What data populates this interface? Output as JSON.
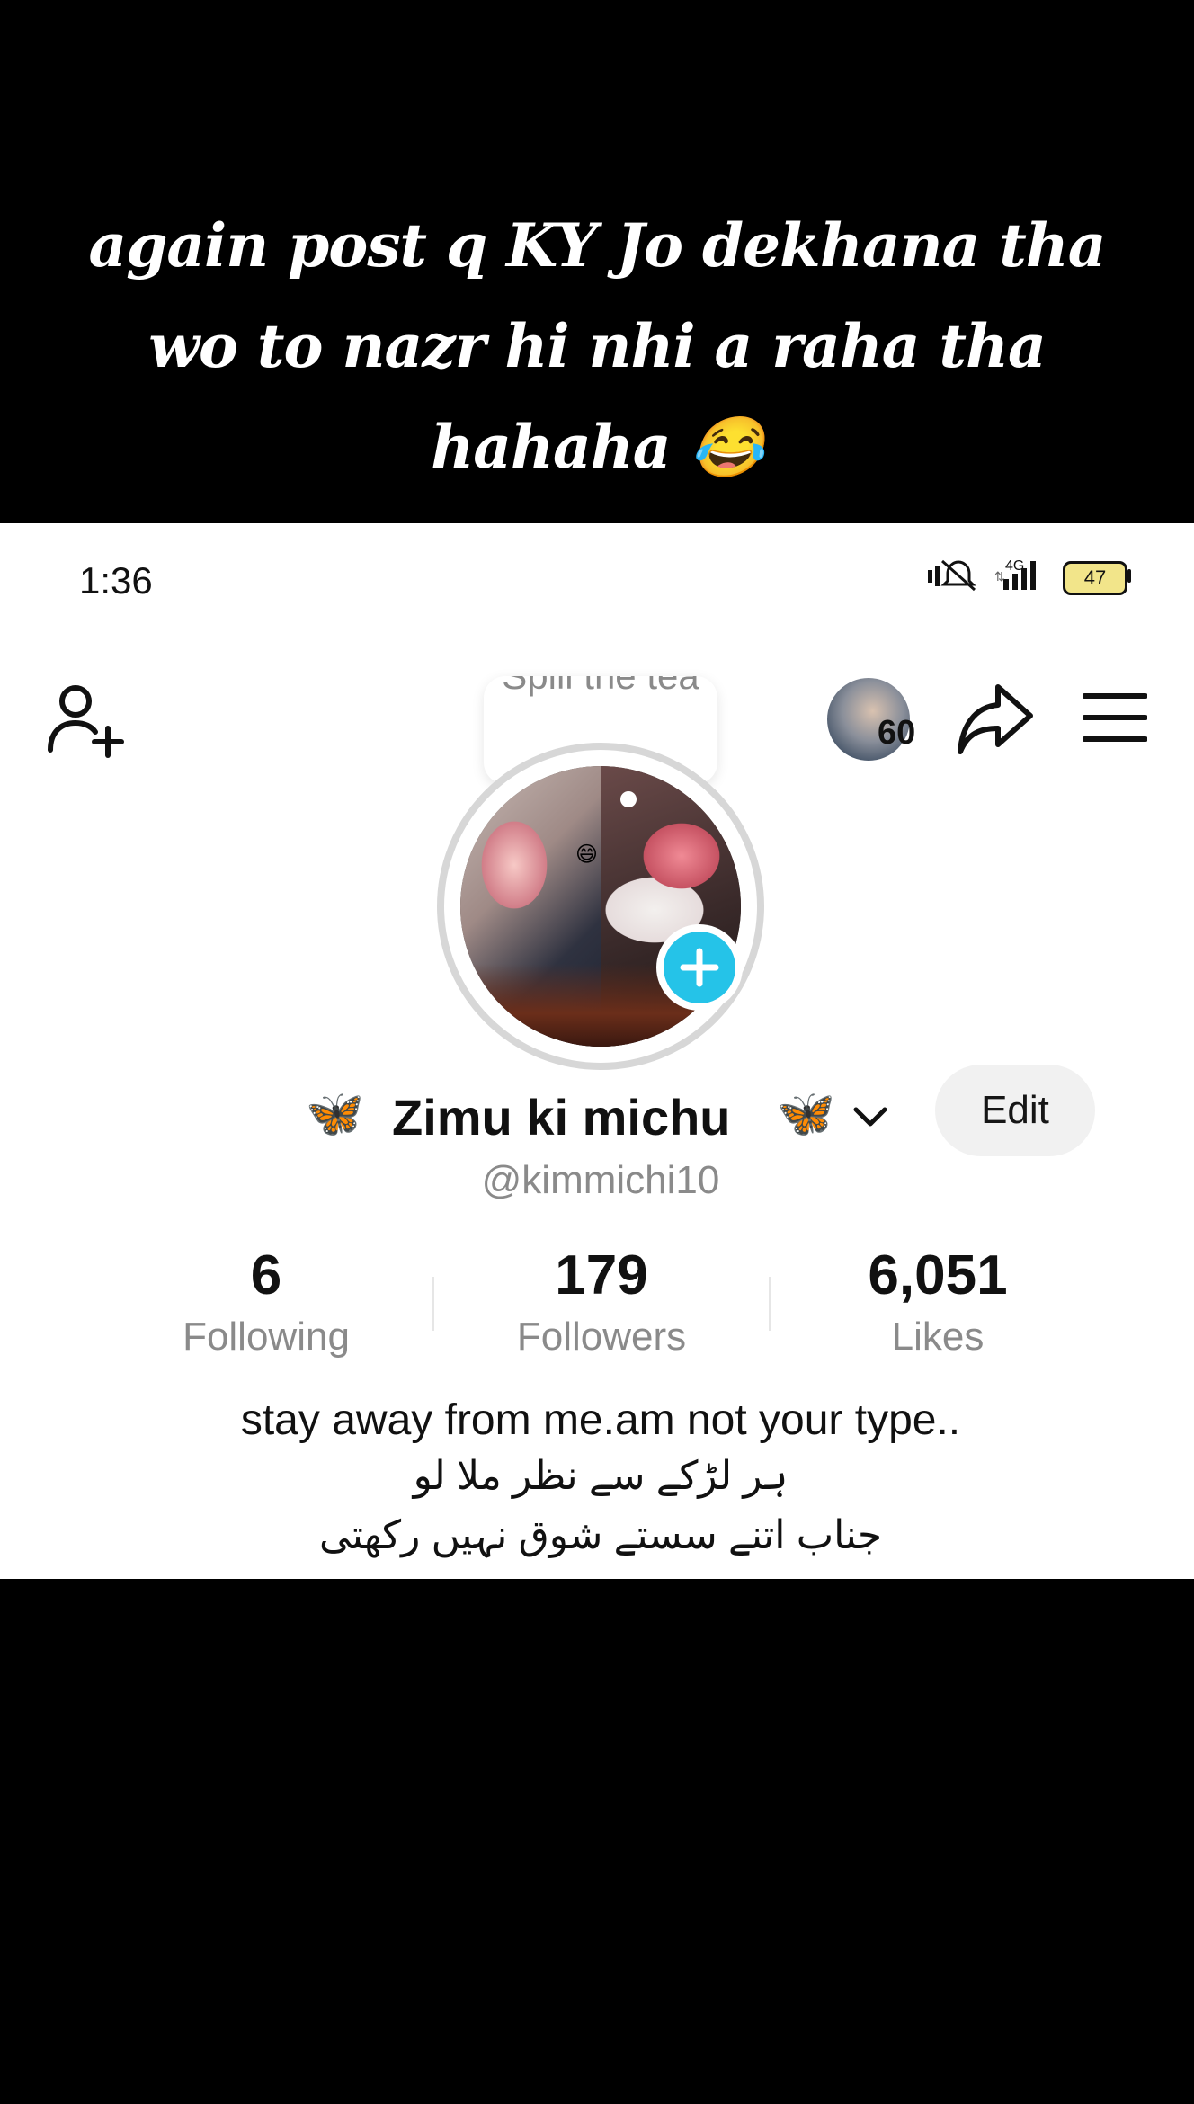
{
  "caption": {
    "line1": "again post q KY Jo dekhana tha",
    "line2": "wo to nazr hi nhi a raha tha",
    "line3": "hahaha 😂"
  },
  "status_bar": {
    "time": "1:36",
    "network": "4G",
    "battery": "47"
  },
  "top_bar": {
    "friend_count": "60",
    "icons": [
      "add-user-icon",
      "share-icon",
      "menu-icon"
    ]
  },
  "profile": {
    "bubble_text": "Spill the tea",
    "display_name": "Zimu ki michu",
    "name_emoji": "🦋",
    "edit_label": "Edit",
    "username": "@kimmichi10"
  },
  "stats": [
    {
      "value": "6",
      "label": "Following"
    },
    {
      "value": "179",
      "label": "Followers"
    },
    {
      "value": "6,051",
      "label": "Likes"
    }
  ],
  "bio": {
    "line1": "stay away from me.am not your type..",
    "line2": "ہر لڑکے سے نظر ملا لو",
    "line3": "جناب اتنے سستے شوق نہیں رکھتی"
  },
  "colors": {
    "accent_plus": "#25c3e8",
    "muted_text": "#8a8a8a",
    "edit_bg": "#f1f1f1"
  }
}
